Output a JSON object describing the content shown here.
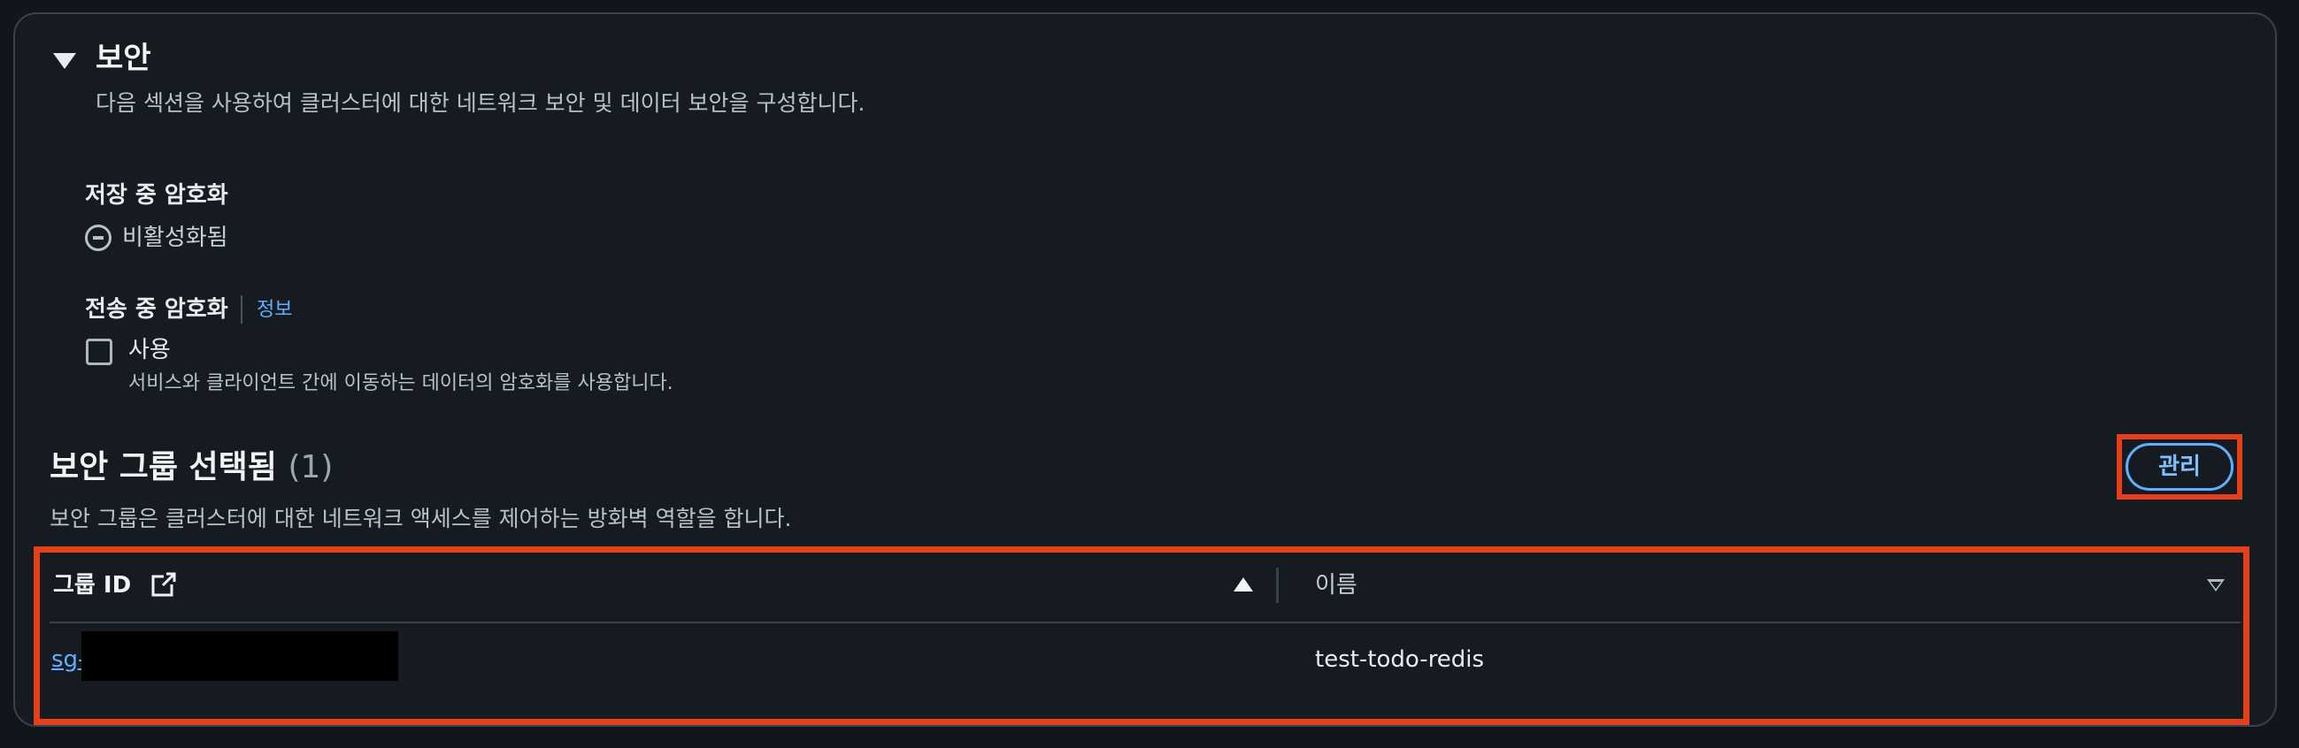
{
  "section": {
    "title": "보안",
    "subtitle": "다음 섹션을 사용하여 클러스터에 대한 네트워크 보안 및 데이터 보안을 구성합니다."
  },
  "encryption_at_rest": {
    "label": "저장 중 암호화",
    "status": "비활성화됨"
  },
  "encryption_in_transit": {
    "label": "전송 중 암호화",
    "info_link": "정보",
    "checkbox_label": "사용",
    "checkbox_checked": false,
    "checkbox_description": "서비스와 클라이언트 간에 이동하는 데이터의 암호화를 사용합니다."
  },
  "security_groups": {
    "title": "보안 그룹 선택됨",
    "count": "(1)",
    "description": "보안 그룹은 클러스터에 대한 네트워크 액세스를 제어하는 방화벽 역할을 합니다.",
    "manage_button": "관리",
    "columns": {
      "group_id": "그룹 ID",
      "name": "이름"
    },
    "rows": [
      {
        "group_id": "sg-",
        "name": "test-todo-redis"
      }
    ]
  },
  "icons": {
    "caret": "caret-down-icon",
    "disabled": "minus-circle-icon",
    "external": "external-link-icon",
    "sort_asc": "sort-ascending-icon",
    "sort_desc": "sort-descending-icon"
  },
  "colors": {
    "background": "#161b22",
    "link": "#5fb0ff",
    "highlight": "#e5401a"
  }
}
